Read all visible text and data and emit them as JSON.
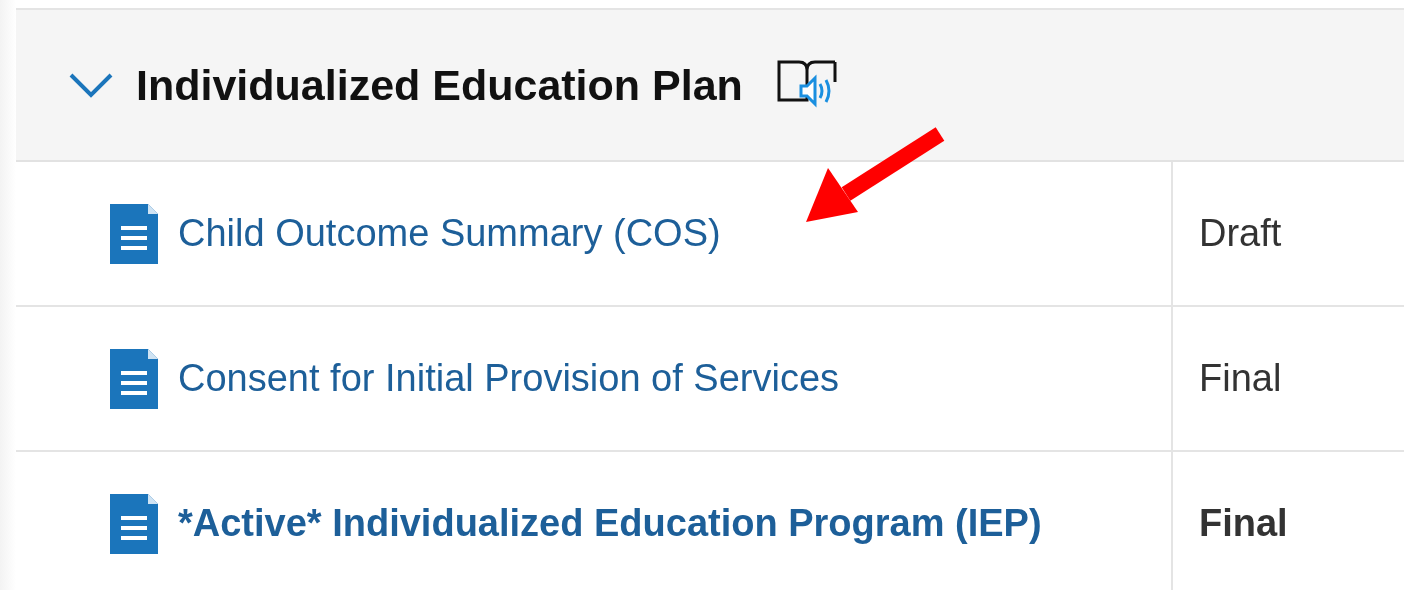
{
  "section": {
    "title": "Individualized Education Plan",
    "expanded": true
  },
  "documents": [
    {
      "name": "Child Outcome Summary (COS)",
      "status": "Draft",
      "active": false
    },
    {
      "name": "Consent for Initial Provision of Services",
      "status": "Final",
      "active": false
    },
    {
      "name": "*Active* Individualized Education Program (IEP)",
      "status": "Final",
      "active": true
    }
  ]
}
